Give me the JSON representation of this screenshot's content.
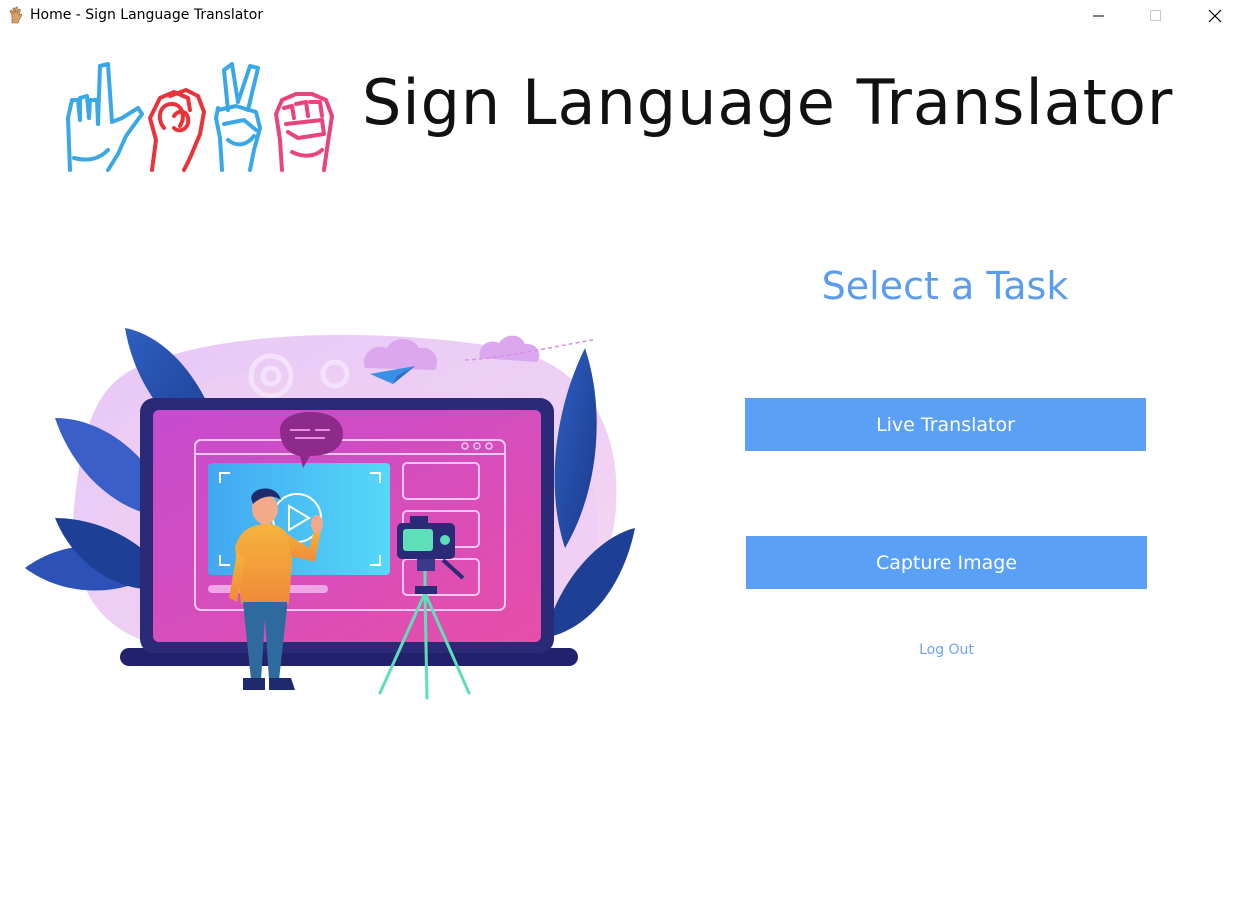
{
  "window": {
    "title": "Home - Sign Language Translator",
    "app_icon": "hand-sign-icon",
    "controls": {
      "minimize_icon": "minimize-icon",
      "maximize_icon": "maximize-icon",
      "close_icon": "close-icon"
    }
  },
  "header": {
    "brand_title": "Sign Language Translator",
    "logo": "sign-language-hands-logo",
    "logo_colors": [
      "#3aa8e8",
      "#e8333a",
      "#3aa8e8",
      "#e8437a"
    ]
  },
  "illustration": {
    "name": "video-recording-illustration"
  },
  "panel": {
    "heading": "Select a Task",
    "buttons": {
      "live_translator": "Live Translator",
      "capture_image": "Capture Image"
    },
    "logout": "Log Out"
  },
  "colors": {
    "accent": "#5aa0f6",
    "heading": "#5b9bf0",
    "link": "#6aa6ee"
  }
}
